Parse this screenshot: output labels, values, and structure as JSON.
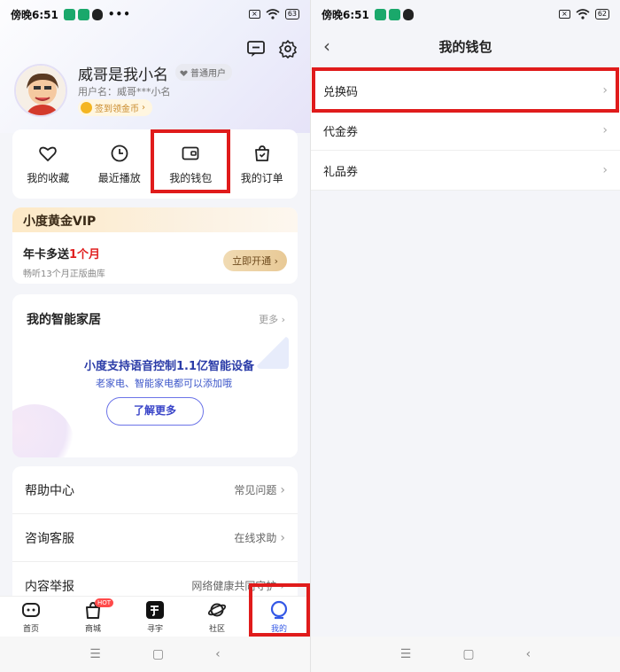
{
  "colors": {
    "accent": "#3458e6",
    "highlight_box": "#e01b1b",
    "vip_red": "#e02020",
    "coin": "#f4b521"
  },
  "left": {
    "status": {
      "time": "傍晚6:51",
      "dots": "•••",
      "battery": "63"
    },
    "header": {
      "nickname": "威哥是我小名",
      "user_tag": "普通用户",
      "username": "用户名：威哥***小名",
      "sign_in": "签到领金币",
      "icons": [
        "message-icon",
        "settings-icon"
      ]
    },
    "quick_actions": [
      {
        "label": "我的收藏",
        "icon": "heart-icon"
      },
      {
        "label": "最近播放",
        "icon": "clock-icon"
      },
      {
        "label": "我的钱包",
        "icon": "wallet-icon"
      },
      {
        "label": "我的订单",
        "icon": "bag-icon"
      }
    ],
    "vip": {
      "title": "小度黄金VIP",
      "promo_prefix": "年卡多送",
      "promo_highlight": "1个月",
      "subtitle": "畅听13个月正版曲库",
      "button": "立即开通"
    },
    "smart_home": {
      "title": "我的智能家居",
      "more": "更多",
      "headline": "小度支持语音控制1.1亿智能设备",
      "subline": "老家电、智能家电都可以添加哦",
      "button": "了解更多"
    },
    "list": [
      {
        "label": "帮助中心",
        "value": "常见问题"
      },
      {
        "label": "咨询客服",
        "value": "在线求助"
      },
      {
        "label": "内容举报",
        "value": "网络健康共同守护"
      }
    ],
    "tabs": [
      {
        "label": "首页",
        "icon": "home-icon"
      },
      {
        "label": "商城",
        "icon": "shopping-bag-icon",
        "badge": "HOT"
      },
      {
        "label": "寻宇",
        "icon": "search-app-icon"
      },
      {
        "label": "社区",
        "icon": "planet-icon"
      },
      {
        "label": "我的",
        "icon": "profile-icon",
        "active": true
      }
    ]
  },
  "right": {
    "status": {
      "time": "傍晚6:51",
      "battery": "62"
    },
    "title": "我的钱包",
    "items": [
      {
        "label": "兑换码"
      },
      {
        "label": "代金券"
      },
      {
        "label": "礼品券"
      }
    ]
  },
  "nav_icons": [
    "menu-icon",
    "home-square-icon",
    "back-icon"
  ]
}
